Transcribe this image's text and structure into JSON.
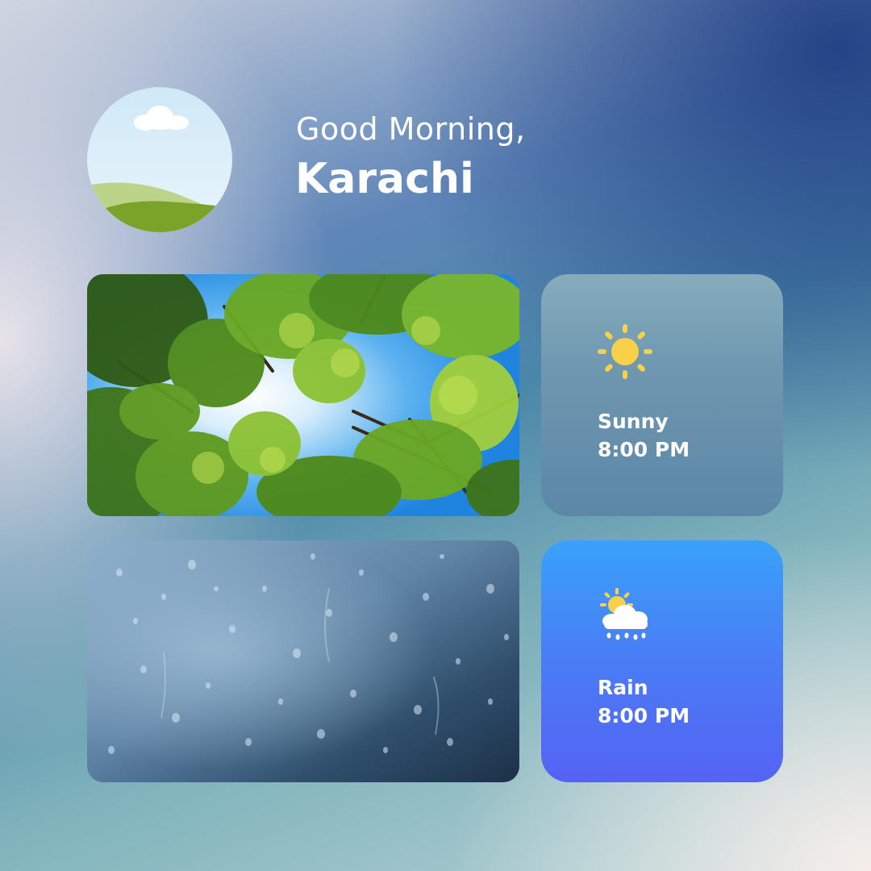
{
  "header": {
    "greeting": "Good Morning,",
    "city": "Karachi"
  },
  "avatar": {
    "icon": "landscape-icon"
  },
  "photos": [
    {
      "name": "trees-canopy",
      "icon": "trees-photo"
    },
    {
      "name": "rain-window",
      "icon": "raindrops-photo"
    }
  ],
  "cards": [
    {
      "condition": "Sunny",
      "time": "8:00 PM",
      "icon": "sun-icon"
    },
    {
      "condition": "Rain",
      "time": "8:00 PM",
      "icon": "sun-cloud-rain-icon"
    }
  ],
  "colors": {
    "sun": "#f9d04a",
    "sunny_card": "#6e97b0",
    "rain_card": "#4a7cf5",
    "text": "#ffffff"
  }
}
